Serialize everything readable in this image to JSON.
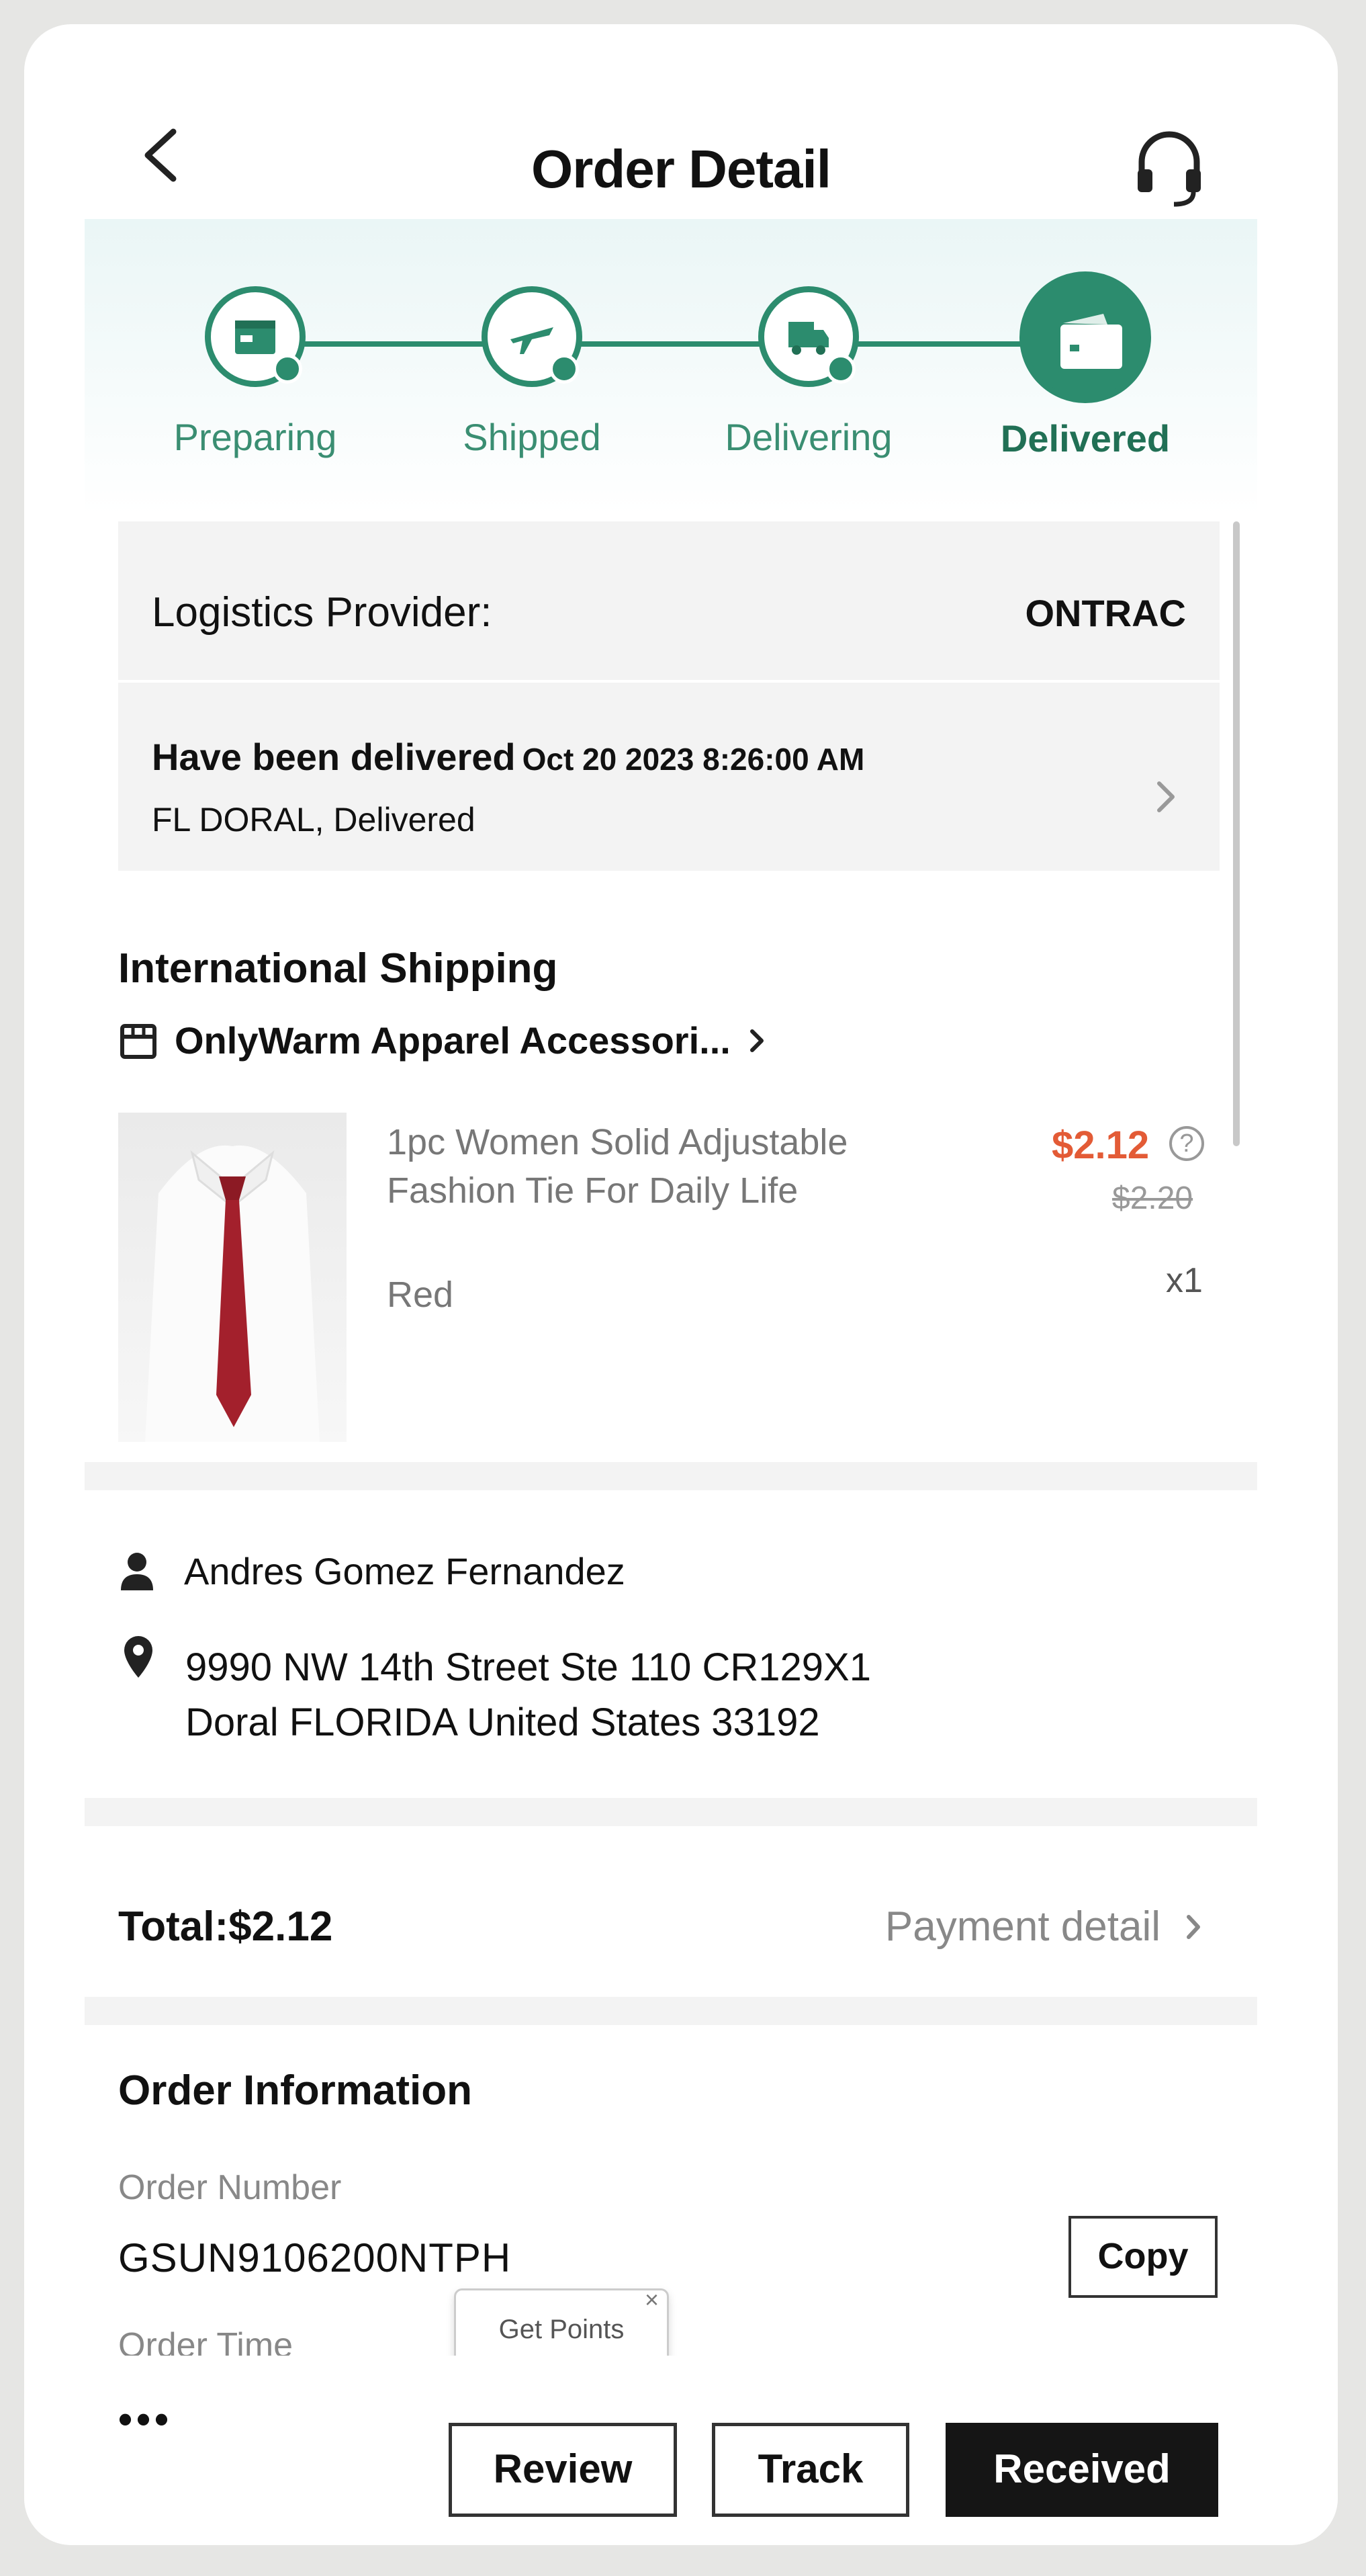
{
  "header": {
    "title": "Order Detail"
  },
  "progress": {
    "steps": [
      {
        "label": "Preparing",
        "icon": "package-icon"
      },
      {
        "label": "Shipped",
        "icon": "plane-icon"
      },
      {
        "label": "Delivering",
        "icon": "truck-icon"
      },
      {
        "label": "Delivered",
        "icon": "wallet-icon"
      }
    ],
    "active_step": "Delivered",
    "accent_color": "#2c8c6e"
  },
  "logistics": {
    "provider_label": "Logistics Provider:",
    "provider_value": "ONTRAC",
    "status_title": "Have been delivered",
    "status_time": "Oct 20 2023 8:26:00 AM",
    "status_location": "FL DORAL, Delivered"
  },
  "shipping": {
    "title": "International Shipping",
    "store_name": "OnlyWarm Apparel Accessori...",
    "product": {
      "title": "1pc Women Solid Adjustable Fashion Tie For Daily Life",
      "variant": "Red",
      "price": "$2.12",
      "original_price": "$2.20",
      "quantity": "x1",
      "price_color": "#e35b36"
    }
  },
  "address": {
    "name": "Andres Gomez Fernandez",
    "line1": "9990 NW 14th Street Ste 110 CR129X1",
    "line2": "Doral FLORIDA United States 33192"
  },
  "payment": {
    "total": "Total:$2.12",
    "detail_link": "Payment detail"
  },
  "order_info": {
    "title": "Order Information",
    "number_label": "Order Number",
    "number_value": "GSUN9106200NTPH",
    "copy_label": "Copy",
    "time_label": "Order Time"
  },
  "bottom_bar": {
    "more_label": "•••",
    "tooltip": "Get Points",
    "tooltip_close": "×",
    "review_label": "Review",
    "track_label": "Track",
    "received_label": "Received"
  }
}
